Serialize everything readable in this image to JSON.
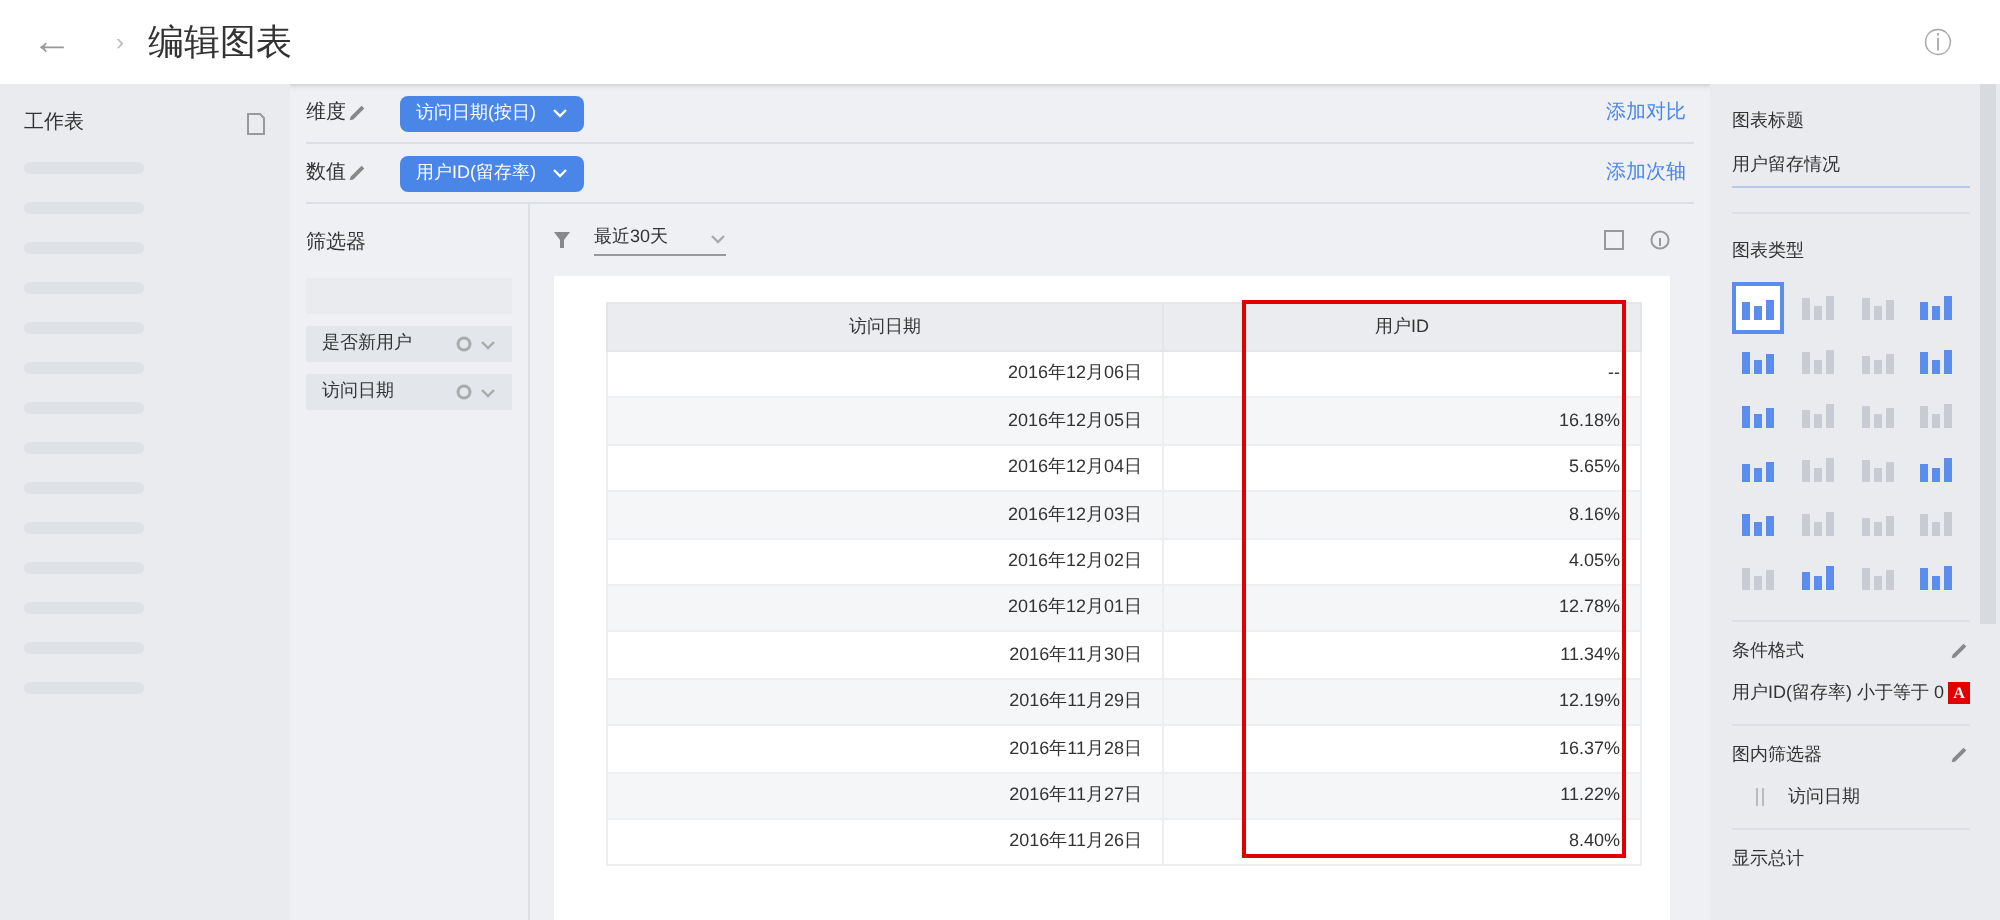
{
  "header": {
    "back": "←",
    "separator": "›",
    "title": "编辑图表",
    "info": "ⓘ"
  },
  "sidebar": {
    "title": "工作表"
  },
  "dimension": {
    "label": "维度",
    "pill": "访问日期(按日)",
    "action": "添加对比"
  },
  "measure": {
    "label": "数值",
    "pill": "用户ID(留存率)",
    "action": "添加次轴"
  },
  "filters": {
    "title": "筛选器",
    "items": [
      {
        "label": "是否新用户"
      },
      {
        "label": "访问日期"
      }
    ]
  },
  "toolbar": {
    "range": "最近30天"
  },
  "table": {
    "columns": [
      "访问日期",
      "用户ID"
    ],
    "rows": [
      [
        "2016年12月06日",
        "--"
      ],
      [
        "2016年12月05日",
        "16.18%"
      ],
      [
        "2016年12月04日",
        "5.65%"
      ],
      [
        "2016年12月03日",
        "8.16%"
      ],
      [
        "2016年12月02日",
        "4.05%"
      ],
      [
        "2016年12月01日",
        "12.78%"
      ],
      [
        "2016年11月30日",
        "11.34%"
      ],
      [
        "2016年11月29日",
        "12.19%"
      ],
      [
        "2016年11月28日",
        "16.37%"
      ],
      [
        "2016年11月27日",
        "11.22%"
      ],
      [
        "2016年11月26日",
        "8.40%"
      ]
    ]
  },
  "panel": {
    "chart_title_label": "图表标题",
    "chart_title": "用户留存情况",
    "chart_type_label": "图表类型",
    "chart_types": [
      {
        "selected": true
      },
      {
        "selected": false
      },
      {
        "selected": false
      },
      {
        "selected": false
      },
      {
        "selected": false
      },
      {
        "selected": false
      },
      {
        "selected": false
      },
      {
        "selected": false
      },
      {
        "selected": false
      },
      {
        "selected": false
      },
      {
        "selected": false
      },
      {
        "selected": false
      },
      {
        "selected": false
      },
      {
        "selected": false
      },
      {
        "selected": false
      },
      {
        "selected": false
      },
      {
        "selected": false
      },
      {
        "selected": false
      },
      {
        "selected": false
      },
      {
        "selected": false
      },
      {
        "selected": false
      },
      {
        "selected": false
      },
      {
        "selected": false
      },
      {
        "selected": false
      }
    ],
    "conditional_label": "条件格式",
    "conditional_rule": "用户ID(留存率) 小于等于 0",
    "conditional_mark": "A",
    "inner_filter_label": "图内筛选器",
    "inner_filter": "访问日期",
    "totals_label": "显示总计"
  }
}
